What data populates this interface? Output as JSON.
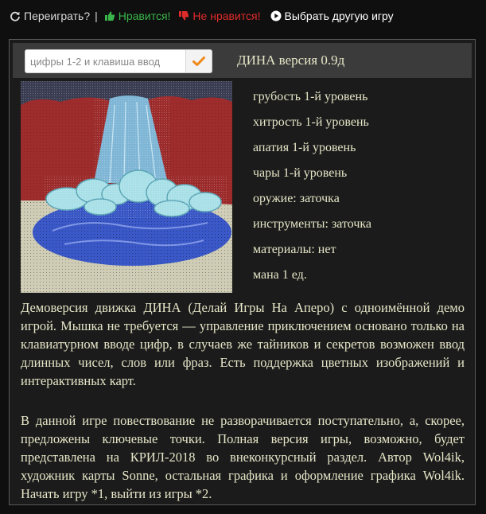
{
  "topbar": {
    "replay": "Переиграть?",
    "separator": "|",
    "like": "Нравится!",
    "dislike": "Не нравится!",
    "choose": "Выбрать другую игру"
  },
  "colors": {
    "like": "#39b54a",
    "dislike": "#e02b2b",
    "text": "#e6e6c8",
    "background": "#1b1b1b",
    "submit_check": "#f08a1c"
  },
  "header": {
    "input_placeholder": "цифры 1-2 и клавиша ввод",
    "input_value": "",
    "title": "ДИНА версия 0.9д"
  },
  "stats": [
    "грубость 1-й уровень",
    "хитрость 1-й уровень",
    "апатия 1-й уровень",
    "чары 1-й уровень",
    "оружие: заточка",
    "инструменты: заточка",
    "материалы: нет",
    "мана 1 ед."
  ],
  "text": {
    "p1": "Демоверсия движка ДИНА (Делай Игры На Аперо) с одноимённой демо игрой. Мышка не требуется — управление приключением основано только на клавиатурном вводе цифр, в случаев же тайников и секретов возможен ввод длинных чисел, слов или фраз. Есть поддержка цветных изображений и интерактивных карт.",
    "p2": "В данной игре повествование не разворачивается поступательно, а, скорее, предложены ключевые точки. Полная версия игры, возможно, будет представлена на КРИЛ-2018 во внеконкурсный раздел. Автор Wol4ik, художник карты Sonne, остальная графика и оформление графика Wol4ik. Начать игру *1, выйти из игры *2."
  },
  "icons": {
    "replay": "refresh-icon",
    "like": "thumbs-up-icon",
    "dislike": "thumbs-down-icon",
    "choose": "play-circle-icon",
    "submit": "checkmark-icon"
  }
}
